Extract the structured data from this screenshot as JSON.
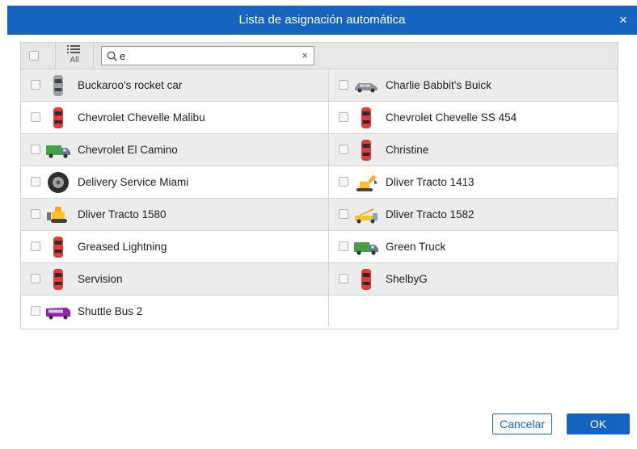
{
  "dialog": {
    "title": "Lista de asignación automática",
    "close_glyph": "×"
  },
  "toolbar": {
    "all_label": "All",
    "search_value": "e",
    "clear_glyph": "×"
  },
  "vehicles": [
    {
      "name": "Buckaroo's rocket car",
      "icon": "gray-car-top-icon"
    },
    {
      "name": "Charlie Babbit's Buick",
      "icon": "gray-sedan-side-icon"
    },
    {
      "name": "Chevrolet Chevelle Malibu",
      "icon": "red-car-top-icon"
    },
    {
      "name": "Chevrolet Chevelle SS 454",
      "icon": "red-car-top-icon"
    },
    {
      "name": "Chevrolet El Camino",
      "icon": "green-truck-side-icon"
    },
    {
      "name": "Christine",
      "icon": "red-car-top-icon"
    },
    {
      "name": "Delivery Service Miami",
      "icon": "tire-icon"
    },
    {
      "name": "Dliver Tracto 1413",
      "icon": "excavator-icon"
    },
    {
      "name": "Dliver Tracto 1580",
      "icon": "bulldozer-icon"
    },
    {
      "name": "Dliver Tracto 1582",
      "icon": "crane-truck-icon"
    },
    {
      "name": "Greased Lightning",
      "icon": "red-car-top-icon"
    },
    {
      "name": "Green Truck",
      "icon": "green-truck-side-icon"
    },
    {
      "name": "Servision",
      "icon": "red-car-top-icon"
    },
    {
      "name": "ShelbyG",
      "icon": "red-car-top-icon"
    },
    {
      "name": "Shuttle Bus 2",
      "icon": "purple-bus-icon"
    }
  ],
  "buttons": {
    "cancel": "Cancelar",
    "ok": "OK"
  },
  "colors": {
    "accent": "#1565c0",
    "row_shade": "#ececec",
    "toolbar_bg": "#e6e6e6"
  }
}
